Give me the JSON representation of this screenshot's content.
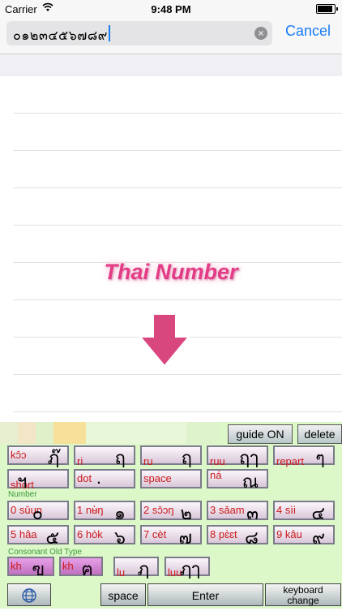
{
  "status_bar": {
    "carrier": "Carrier",
    "time": "9:48 PM",
    "battery_level": 0.95
  },
  "search": {
    "value": "๐๑๒๓๔๕๖๗๘๙",
    "cancel_label": "Cancel"
  },
  "overlay": {
    "title": "Thai Number"
  },
  "keyboard": {
    "guide_label": "guide ON",
    "delete_label": "delete",
    "special_row1": [
      {
        "label": "kɔ̂ɔ",
        "glyph": "ฦ๊"
      },
      {
        "label": "ri",
        "glyph": "ฤ"
      },
      {
        "label": "ru",
        "glyph": "ฤ"
      },
      {
        "label": "ruu",
        "glyph": "ฤๅ"
      },
      {
        "label": "repart",
        "glyph": "ๆ"
      }
    ],
    "special_row2": [
      {
        "label": "short",
        "glyph": "ฯ"
      },
      {
        "label": "dot",
        "glyph": "."
      },
      {
        "label": "space",
        "glyph": ""
      },
      {
        "label": "ná",
        "glyph": "ณ"
      }
    ],
    "number_section_label": "Number",
    "number_row1": [
      {
        "label": "0 sǔun",
        "glyph": "๐"
      },
      {
        "label": "1 nʉ̀ŋ",
        "glyph": "๑"
      },
      {
        "label": "2 sɔ̌ɔŋ",
        "glyph": "๒"
      },
      {
        "label": "3 sǎam",
        "glyph": "๓"
      },
      {
        "label": "4 sìi",
        "glyph": "๔"
      }
    ],
    "number_row2": [
      {
        "label": "5 hâa",
        "glyph": "๕"
      },
      {
        "label": "6 hòk",
        "glyph": "๖"
      },
      {
        "label": "7 cèt",
        "glyph": "๗"
      },
      {
        "label": "8 pɛ̀ɛt",
        "glyph": "๘"
      },
      {
        "label": "9 kâu",
        "glyph": "๙"
      }
    ],
    "consonant_section_label": "Consonant Old Type",
    "consonant_row": [
      {
        "label": "kh",
        "glyph": "ฃ"
      },
      {
        "label": "kh",
        "glyph": "ฅ"
      },
      {
        "label": "lu",
        "glyph": "ฦ"
      },
      {
        "label": "luu",
        "glyph": "ฦๅ"
      }
    ],
    "space_label": "space",
    "enter_label": "Enter",
    "keyboard_change_label_1": "keyboard",
    "keyboard_change_label_2": "change"
  },
  "colors": {
    "accent": "#1a7cf5",
    "overlay_pink": "#e33b86",
    "keyboard_bg": "#dcf7c8",
    "key_label_red": "#cc1a1a",
    "section_label_green": "#3a9a3a"
  },
  "icons": {
    "clear": "clear-circle-icon",
    "arrow": "down-arrow-icon",
    "globe": "globe-icon",
    "wifi": "wifi-icon"
  }
}
